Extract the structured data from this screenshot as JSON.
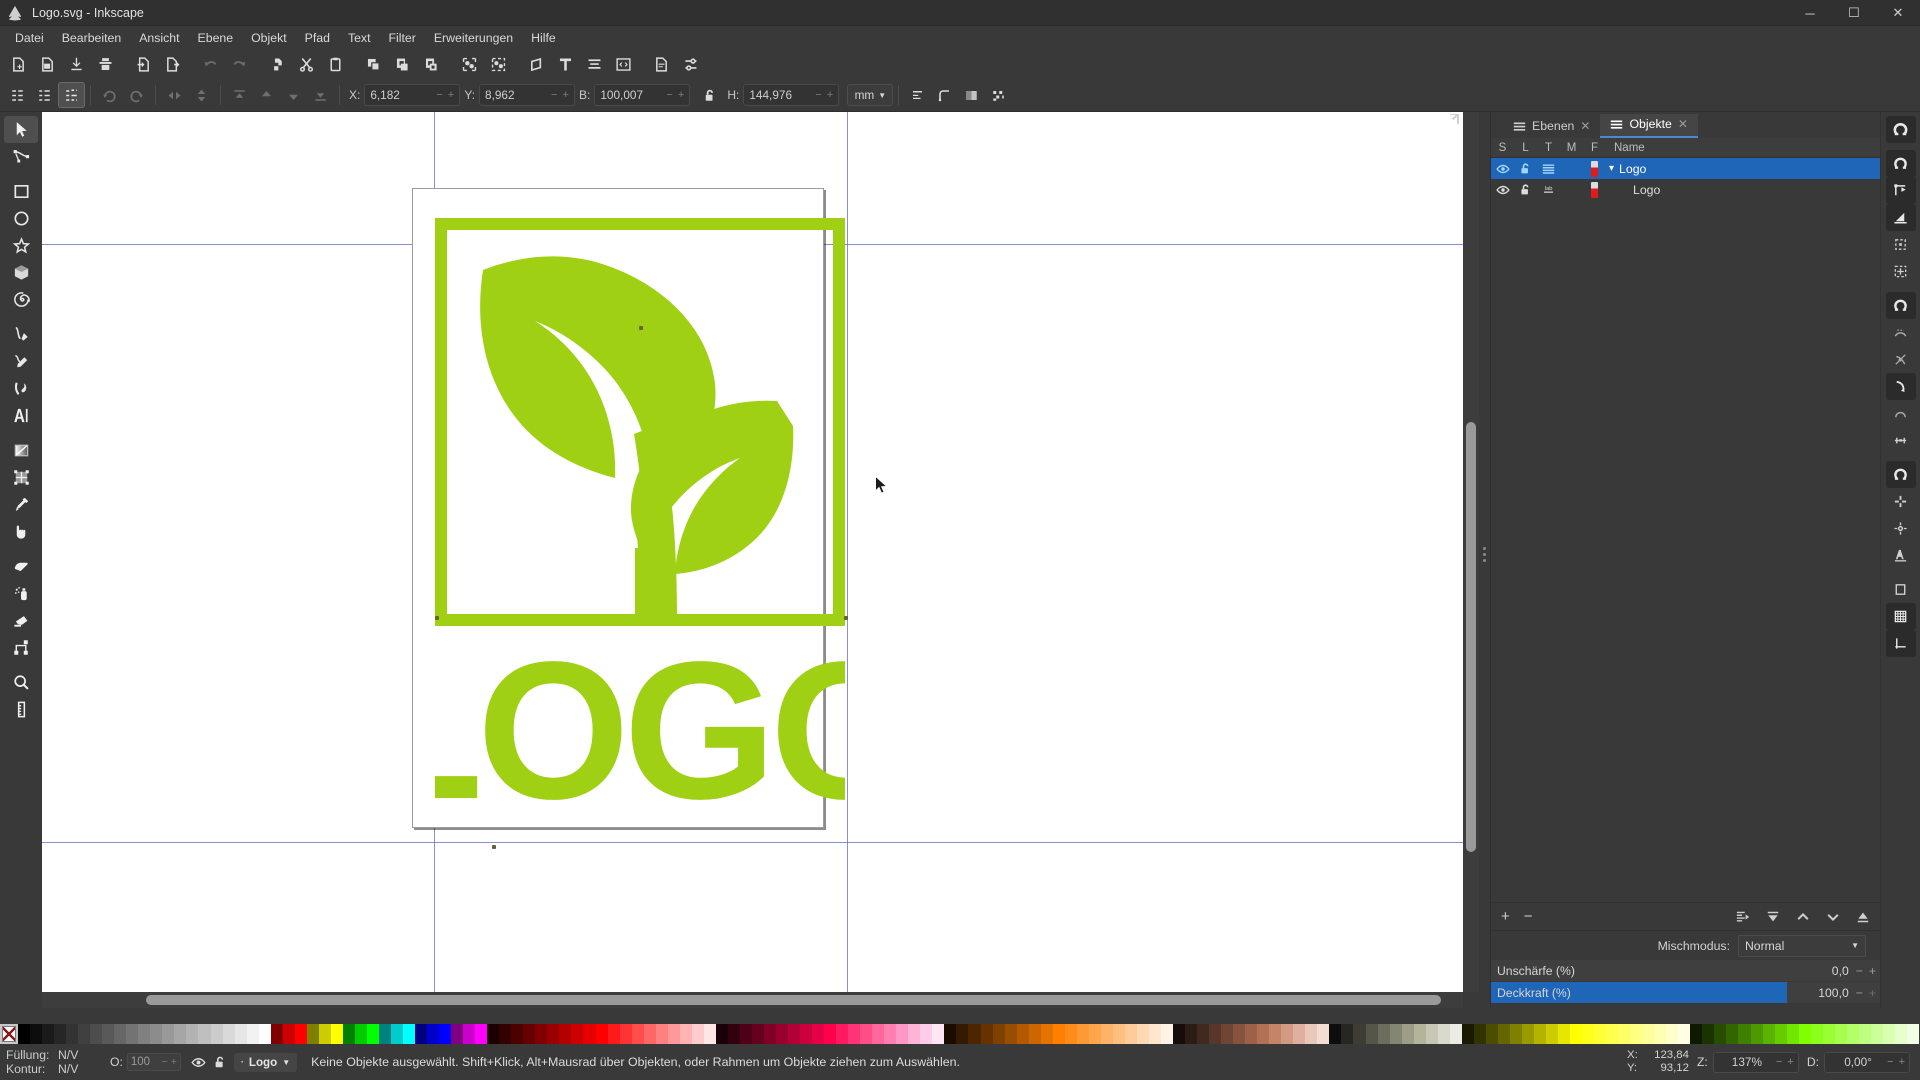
{
  "window": {
    "title": "Logo.svg - Inkscape",
    "app_icon": "inkscape-icon",
    "controls": {
      "minimize": "─",
      "maximize": "☐",
      "close": "✕"
    }
  },
  "menu": {
    "items": [
      "Datei",
      "Bearbeiten",
      "Ansicht",
      "Ebene",
      "Objekt",
      "Pfad",
      "Text",
      "Filter",
      "Erweiterungen",
      "Hilfe"
    ]
  },
  "command_toolbar": {
    "buttons": [
      "new-document-icon",
      "open-document-icon",
      "save-document-icon",
      "print-icon",
      "import-icon",
      "export-icon",
      "undo-icon",
      "redo-icon",
      "copy-icon",
      "cut-icon",
      "paste-icon",
      "duplicate-icon",
      "clone-icon",
      "unlink-clone-icon",
      "group-icon",
      "ungroup-icon",
      "fill-stroke-icon",
      "text-tool-icon",
      "align-icon",
      "xml-editor-icon",
      "document-properties-icon",
      "preferences-icon"
    ]
  },
  "tool_controls": {
    "select_all_icon": "select-all-icon",
    "select_all_layers_icon": "select-all-layers-icon",
    "deselect_icon": "deselect-icon",
    "rotate_ccw_icon": "rotate-ccw-icon",
    "rotate_cw_icon": "rotate-cw-icon",
    "flip_h_icon": "flip-horizontal-icon",
    "flip_v_icon": "flip-vertical-icon",
    "raise_top_icon": "raise-to-top-icon",
    "raise_icon": "raise-icon",
    "lower_icon": "lower-icon",
    "lower_bottom_icon": "lower-to-bottom-icon",
    "fields": [
      {
        "label": "X:",
        "value": "6,182"
      },
      {
        "label": "Y:",
        "value": "8,962"
      },
      {
        "label": "B:",
        "value": "100,007"
      },
      {
        "label": "H:",
        "value": "144,976"
      }
    ],
    "lock_icon": "lock-open-icon",
    "unit": "mm",
    "affect_buttons": [
      "affect-stroke-icon",
      "affect-corners-icon",
      "affect-gradients-icon",
      "affect-patterns-icon"
    ]
  },
  "toolbox": {
    "tools": [
      {
        "name": "selector-tool",
        "icon": "arrow-cursor-icon",
        "selected": true
      },
      {
        "name": "node-tool",
        "icon": "node-editor-icon",
        "selected": false
      },
      {
        "name": "rectangle-tool",
        "icon": "square-icon",
        "selected": false
      },
      {
        "name": "ellipse-tool",
        "icon": "circle-icon",
        "selected": false
      },
      {
        "name": "star-tool",
        "icon": "star-icon",
        "selected": false
      },
      {
        "name": "3dbox-tool",
        "icon": "cube-icon",
        "selected": false
      },
      {
        "name": "spiral-tool",
        "icon": "spiral-icon",
        "selected": false
      },
      {
        "name": "pencil-tool",
        "icon": "freehand-icon",
        "selected": false
      },
      {
        "name": "bezier-tool",
        "icon": "pen-icon",
        "selected": false
      },
      {
        "name": "calligraphy-tool",
        "icon": "calligraphy-icon",
        "selected": false
      },
      {
        "name": "text-tool",
        "icon": "text-a-icon",
        "selected": false
      },
      {
        "name": "gradient-tool",
        "icon": "gradient-icon",
        "selected": false
      },
      {
        "name": "mesh-tool",
        "icon": "mesh-gradient-icon",
        "selected": false
      },
      {
        "name": "dropper-tool",
        "icon": "eyedropper-icon",
        "selected": false
      },
      {
        "name": "tweak-tool",
        "icon": "tweak-hand-icon",
        "selected": false
      },
      {
        "name": "paintbucket-tool",
        "icon": "paint-bucket-icon",
        "selected": false
      },
      {
        "name": "spray-tool",
        "icon": "spray-can-icon",
        "selected": false
      },
      {
        "name": "eraser-tool",
        "icon": "eraser-icon",
        "selected": false
      },
      {
        "name": "connector-tool",
        "icon": "connector-icon",
        "selected": false
      },
      {
        "name": "zoom-tool",
        "icon": "magnifier-icon",
        "selected": false
      },
      {
        "name": "measure-tool",
        "icon": "measure-icon",
        "selected": false
      }
    ]
  },
  "canvas": {
    "logo": {
      "word": "LOGO",
      "green": "#9fd013"
    },
    "cursor_arrow": "mouse-pointer"
  },
  "dock": {
    "tabs": [
      {
        "label": "Ebenen",
        "icon": "layers-icon",
        "active": false
      },
      {
        "label": "Objekte",
        "icon": "objects-icon",
        "active": true
      }
    ],
    "columns": [
      "S",
      "L",
      "T",
      "M",
      "F",
      "Name"
    ],
    "rows": [
      {
        "name": "Logo",
        "selected": true,
        "indent": 0,
        "expander": "▾",
        "visibility_icon": "eye-icon",
        "lock_icon": "lock-open-icon",
        "type_icon": "group-icon",
        "fill": "#e01b1b"
      },
      {
        "name": "Logo",
        "selected": false,
        "indent": 1,
        "expander": "",
        "visibility_icon": "eye-icon",
        "lock_icon": "lock-open-icon",
        "type_icon": "label-icon",
        "fill": "#e01b1b"
      }
    ],
    "buttons": {
      "add": "+",
      "remove": "−",
      "right": [
        "move-to-layer-icon",
        "raise-to-top-icon",
        "raise-icon",
        "lower-icon",
        "lower-to-bottom-icon"
      ]
    },
    "blend": {
      "label": "Mischmodus:",
      "value": "Normal",
      "caret": "▼"
    },
    "sliders": [
      {
        "label": "Unschärfe (%)",
        "value": "0,0",
        "percent": 0,
        "highlighted": false
      },
      {
        "label": "Deckkraft (%)",
        "value": "100,0",
        "percent": 100,
        "highlighted": true
      }
    ]
  },
  "snapbar": {
    "items": [
      {
        "name": "snap-enable",
        "icon": "magnet-icon",
        "on": true
      },
      {
        "name": "snap-bounding-boxes",
        "icon": "magnet-icon",
        "on": true
      },
      {
        "name": "snap-bbox-edges",
        "icon": "bbox-corner-icon",
        "on": true
      },
      {
        "name": "snap-bbox-corners",
        "icon": "bbox-edge-icon",
        "on": true
      },
      {
        "name": "snap-bbox-edge-midpoints",
        "icon": "bbox-midpoint-icon",
        "on": false
      },
      {
        "name": "snap-bbox-centers",
        "icon": "bbox-center-icon",
        "on": false
      },
      {
        "name": "snap-nodes-paths",
        "icon": "magnet-icon",
        "on": true
      },
      {
        "name": "snap-paths",
        "icon": "path-icon",
        "on": false
      },
      {
        "name": "snap-path-intersections",
        "icon": "intersection-icon",
        "on": false
      },
      {
        "name": "snap-cusp-nodes",
        "icon": "cusp-node-icon",
        "on": true
      },
      {
        "name": "snap-smooth-nodes",
        "icon": "smooth-node-icon",
        "on": false
      },
      {
        "name": "snap-midpoints",
        "icon": "line-midpoint-icon",
        "on": false
      },
      {
        "name": "snap-others",
        "icon": "magnet-icon",
        "on": true
      },
      {
        "name": "snap-object-centers",
        "icon": "object-center-icon",
        "on": false
      },
      {
        "name": "snap-rotation-centers",
        "icon": "rotation-center-icon",
        "on": false
      },
      {
        "name": "snap-text-baselines",
        "icon": "text-baseline-icon",
        "on": false
      },
      {
        "name": "snap-page-border",
        "icon": "page-border-icon",
        "on": false
      },
      {
        "name": "snap-grids",
        "icon": "grid-icon",
        "on": true
      },
      {
        "name": "snap-guides",
        "icon": "guide-icon",
        "on": true
      }
    ]
  },
  "palette": {
    "none_swatch": "none-color-swatch",
    "colors": [
      "#000000",
      "#0d0d0d",
      "#1a1a1a",
      "#262626",
      "#333333",
      "#404040",
      "#4d4d4d",
      "#595959",
      "#666666",
      "#737373",
      "#808080",
      "#8c8c8c",
      "#999999",
      "#a6a6a6",
      "#b3b3b3",
      "#bfbfbf",
      "#cccccc",
      "#d9d9d9",
      "#e6e6e6",
      "#f2f2f2",
      "#ffffff",
      "#800000",
      "#cc0000",
      "#ff0000",
      "#808000",
      "#cccc00",
      "#ffff00",
      "#008000",
      "#00cc00",
      "#00ff00",
      "#008080",
      "#00cccc",
      "#00ffff",
      "#000080",
      "#0000cc",
      "#0000ff",
      "#800080",
      "#cc00cc",
      "#ff00ff",
      "#1a0000",
      "#330000",
      "#4d0000",
      "#660000",
      "#800000",
      "#990000",
      "#b30000",
      "#cc0000",
      "#e60000",
      "#ff0000",
      "#ff1a1a",
      "#ff3333",
      "#ff4d4d",
      "#ff6666",
      "#ff8080",
      "#ff9999",
      "#ffb3b3",
      "#ffcccc",
      "#ffe6e6",
      "#1a0008",
      "#33000f",
      "#4d0017",
      "#66001f",
      "#800026",
      "#99002e",
      "#b30036",
      "#cc003d",
      "#e60045",
      "#ff004d",
      "#ff1a61",
      "#ff3375",
      "#ff4d88",
      "#ff669c",
      "#ff80b0",
      "#ff99c4",
      "#ffb3d7",
      "#ffcceb",
      "#ffe6f5",
      "#1a0d00",
      "#331a00",
      "#4d2600",
      "#663300",
      "#804000",
      "#994d00",
      "#b35900",
      "#cc6600",
      "#e67300",
      "#ff8000",
      "#ff8c1a",
      "#ff9933",
      "#ffa64d",
      "#ffb366",
      "#ffbf80",
      "#ffcc99",
      "#ffd9b3",
      "#ffe6cc",
      "#fff2e6",
      "#140d0a",
      "#2b1c15",
      "#42291f",
      "#58372a",
      "#6f4534",
      "#86533f",
      "#9d6149",
      "#b47054",
      "#c58468",
      "#d19a83",
      "#ddb19e",
      "#e9c8b9",
      "#f4ded4",
      "#0d0d0d",
      "#262622",
      "#3d3d36",
      "#55554a",
      "#6d6d5f",
      "#858573",
      "#9d9d88",
      "#b4b49c",
      "#c7c7b5",
      "#d9d9cd",
      "#ececE5",
      "#1a1a00",
      "#333300",
      "#4d4d00",
      "#666600",
      "#808000",
      "#999900",
      "#b3b300",
      "#cccc00",
      "#e6e600",
      "#ffff00",
      "#ffff1a",
      "#ffff33",
      "#ffff4d",
      "#ffff66",
      "#ffff80",
      "#ffff99",
      "#ffffb3",
      "#ffffcc",
      "#ffffe6",
      "#0d1a00",
      "#1a3300",
      "#264d00",
      "#336600",
      "#408000",
      "#4d9900",
      "#59b300",
      "#66cc00",
      "#73e600",
      "#80ff00",
      "#8cff1a",
      "#99ff33",
      "#a6ff4d",
      "#b3ff66",
      "#bfff80",
      "#ccff99",
      "#d9ffb3",
      "#e6ffcc",
      "#f2ffe6"
    ]
  },
  "statusbar": {
    "fill_label": "Füllung:",
    "fill_value": "N/V",
    "stroke_label": "Kontur:",
    "stroke_value": "N/V",
    "opacity_label": "O:",
    "opacity_value": "100",
    "visibility_icon": "eye-icon",
    "lock_icon": "lock-open-icon",
    "layer_name": "Logo",
    "layer_caret": "▾",
    "message": "Keine Objekte ausgewählt. Shift+Klick, Alt+Mausrad über Objekten, oder Rahmen um Objekte ziehen zum Auswählen.",
    "pointer": {
      "x_label": "X:",
      "x_value": "123,84",
      "y_label": "Y:",
      "y_value": "93,12"
    },
    "zoom": {
      "label": "Z:",
      "value": "137%"
    },
    "rotation": {
      "label": "D:",
      "value": "0,00°"
    }
  }
}
